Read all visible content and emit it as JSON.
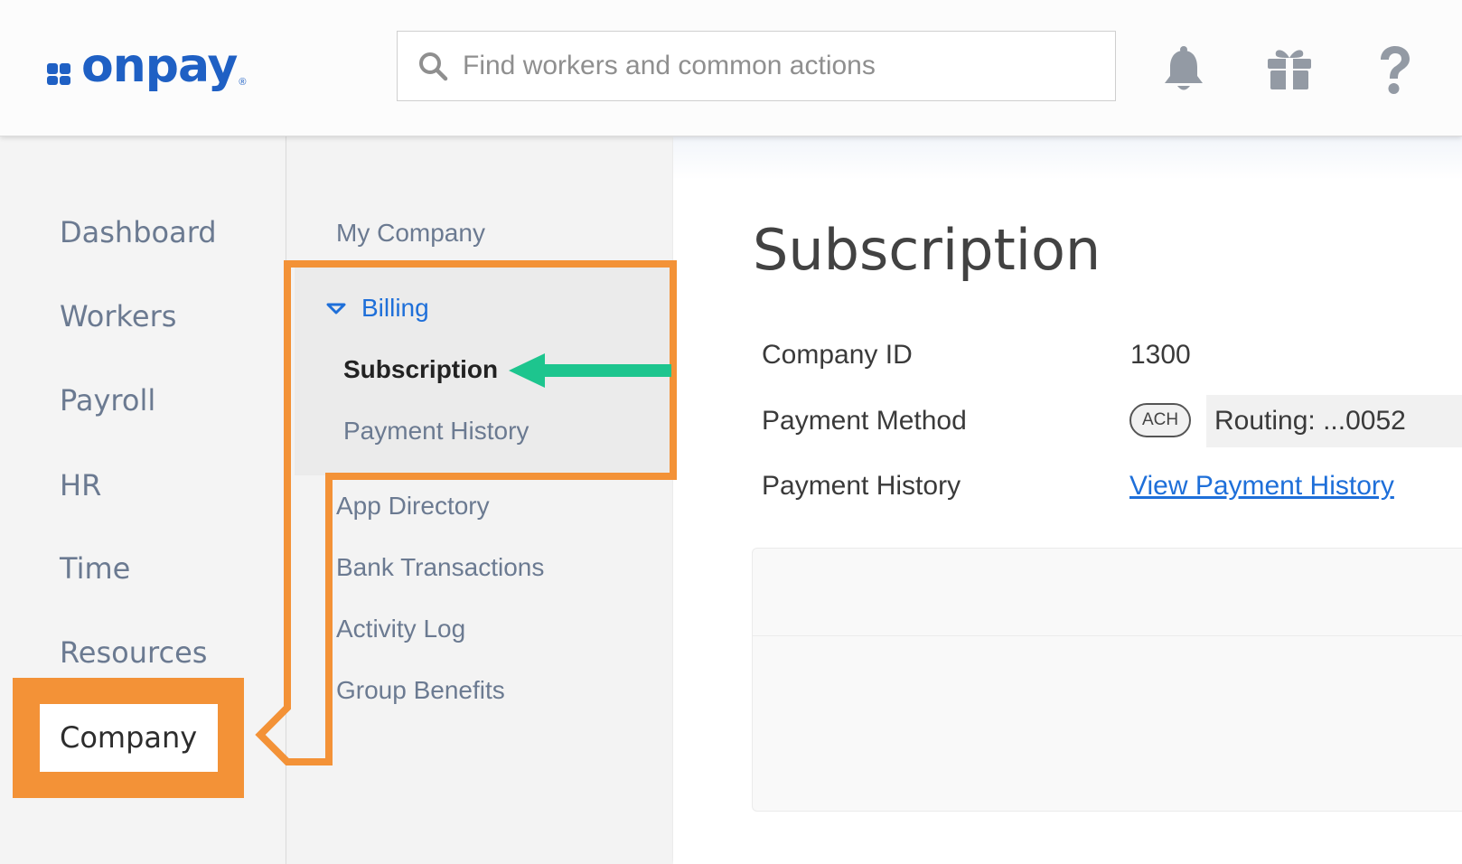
{
  "header": {
    "logo_text": "onpay",
    "logo_reg": "®",
    "search_placeholder": "Find workers and common actions",
    "icons": [
      "bell-icon",
      "gift-icon",
      "question-icon"
    ]
  },
  "primary_nav": {
    "items": [
      {
        "label": "Dashboard"
      },
      {
        "label": "Workers"
      },
      {
        "label": "Payroll"
      },
      {
        "label": "HR"
      },
      {
        "label": "Time"
      },
      {
        "label": "Resources"
      },
      {
        "label": "Company",
        "active": true
      }
    ]
  },
  "secondary_nav": {
    "my_company": "My Company",
    "billing": {
      "label": "Billing",
      "expanded": true,
      "children": [
        {
          "label": "Subscription",
          "active": true
        },
        {
          "label": "Payment History"
        }
      ]
    },
    "items": [
      {
        "label": "App Directory"
      },
      {
        "label": "Bank Transactions"
      },
      {
        "label": "Activity Log"
      },
      {
        "label": "Group Benefits"
      }
    ]
  },
  "main": {
    "title": "Subscription",
    "rows": [
      {
        "label": "Company ID",
        "value": "1300"
      },
      {
        "label": "Payment Method",
        "badge": "ACH",
        "value": "Routing: ...0052"
      },
      {
        "label": "Payment History",
        "link": "View Payment History"
      }
    ]
  },
  "colors": {
    "brand": "#1f60c4",
    "nav_text": "#6b7a91",
    "link": "#1e6fd9",
    "highlight_orange": "#f39237",
    "arrow_green": "#1dc58e"
  }
}
